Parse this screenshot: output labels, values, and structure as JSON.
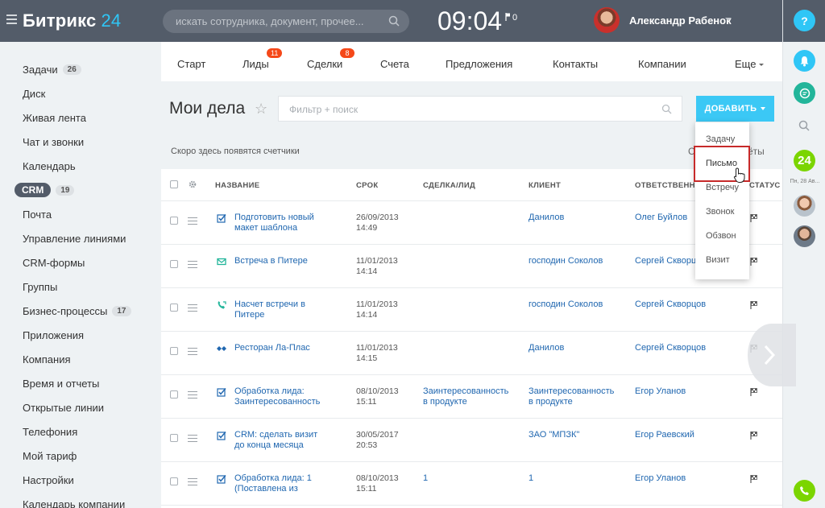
{
  "header": {
    "logo_text": "Битрикс",
    "logo_num": "24",
    "search_placeholder": "искать сотрудника, документ, прочее...",
    "clock": "09:04",
    "flag_count": "0",
    "user_name": "Александр Рабенок"
  },
  "right_panel": {
    "help_label": "?",
    "b24_label": "24",
    "date_label": "Пн, 28 Ав..."
  },
  "sidebar": {
    "items": [
      {
        "label": "Задачи",
        "badge": "26"
      },
      {
        "label": "Диск"
      },
      {
        "label": "Живая лента"
      },
      {
        "label": "Чат и звонки"
      },
      {
        "label": "Календарь"
      },
      {
        "label": "CRM",
        "badge": "19",
        "active": true
      },
      {
        "label": "Почта"
      },
      {
        "label": "Управление линиями"
      },
      {
        "label": "CRM-формы"
      },
      {
        "label": "Группы"
      },
      {
        "label": "Бизнес-процессы",
        "badge": "17"
      },
      {
        "label": "Приложения"
      },
      {
        "label": "Компания"
      },
      {
        "label": "Время и отчеты"
      },
      {
        "label": "Открытые линии"
      },
      {
        "label": "Телефония"
      },
      {
        "label": "Мой тариф"
      },
      {
        "label": "Настройки"
      },
      {
        "label": "Календарь компании"
      }
    ]
  },
  "tabs": {
    "start": "Старт",
    "leads": "Лиды",
    "leads_count": "11",
    "deals": "Сделки",
    "deals_count": "8",
    "invoices": "Счета",
    "offers": "Предложения",
    "contacts": "Контакты",
    "companies": "Компании",
    "more": "Еще"
  },
  "page": {
    "title": "Мои дела",
    "filter_placeholder": "Фильтр + поиск",
    "add_button": "ДОБАВИТЬ",
    "counters_text": "Скоро здесь появятся счетчики",
    "counters_right_a": "С",
    "counters_right_b": "ёты"
  },
  "table": {
    "headers": {
      "name": "НАЗВАНИЕ",
      "deadline": "СРОК",
      "deal": "СДЕЛКА/ЛИД",
      "client": "КЛИЕНТ",
      "responsible": "ОТВЕТСТВЕННЫ",
      "status": "СТАТУС"
    },
    "rows": [
      {
        "icon": "task-icon",
        "name1": "Подготовить новый",
        "name2": "макет шаблона",
        "date": "26/09/2013",
        "time": "14:49",
        "deal1": "",
        "deal2": "",
        "client1": "Данилов",
        "client2": "",
        "resp": "Олег Буйлов"
      },
      {
        "icon": "email-icon",
        "name1": "Встреча в Питере",
        "name2": "",
        "date": "11/01/2013",
        "time": "14:14",
        "deal1": "",
        "deal2": "",
        "client1": "господин Соколов",
        "client2": "",
        "resp": "Сергей Скворц"
      },
      {
        "icon": "call-icon",
        "name1": "Насчет встречи в",
        "name2": "Питере",
        "date": "11/01/2013",
        "time": "14:14",
        "deal1": "",
        "deal2": "",
        "client1": "господин Соколов",
        "client2": "",
        "resp": "Сергей Скворцов"
      },
      {
        "icon": "meeting-icon",
        "name1": "Ресторан Ла-Плас",
        "name2": "",
        "date": "11/01/2013",
        "time": "14:15",
        "deal1": "",
        "deal2": "",
        "client1": "Данилов",
        "client2": "",
        "resp": "Сергей Скворцов"
      },
      {
        "icon": "task-icon",
        "name1": "Обработка лида:",
        "name2": "Заинтересованность",
        "date": "08/10/2013",
        "time": "15:11",
        "deal1": "Заинтересованность",
        "deal2": "в продукте",
        "client1": "Заинтересованность",
        "client2": "в продукте",
        "resp": "Егор Уланов"
      },
      {
        "icon": "task-icon",
        "name1": "CRM: сделать визит",
        "name2": "до конца месяца",
        "date": "30/05/2017",
        "time": "20:53",
        "deal1": "",
        "deal2": "",
        "client1": "ЗАО \"МПЗК\"",
        "client2": "",
        "resp": "Егор Раевский"
      },
      {
        "icon": "task-icon",
        "name1": "Обработка лида: 1",
        "name2": "(Поставлена из",
        "date": "08/10/2013",
        "time": "15:11",
        "deal1": "1",
        "deal2": "",
        "client1": "1",
        "client2": "",
        "resp": "Егор Уланов"
      }
    ]
  },
  "dropdown": {
    "items": [
      "Задачу",
      "Письмо",
      "Встречу",
      "Звонок",
      "Обзвон",
      "Визит"
    ]
  },
  "colors": {
    "topbar": "#535c69",
    "accent": "#3bc8f5",
    "counter": "#f54819",
    "link": "#2067b0",
    "highlight": "#c72a2a"
  }
}
